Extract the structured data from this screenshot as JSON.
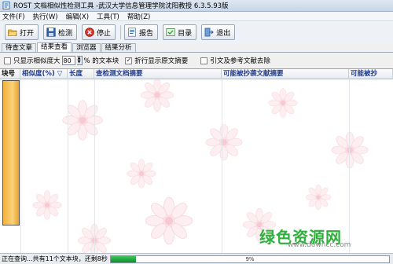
{
  "window": {
    "title": "ROST 文档相似性检测工具 -武汉大学信息管理学院沈阳教授 6.3.5.93版"
  },
  "menu": [
    "文件(F)",
    "执行(W)",
    "编辑(X)",
    "工具(T)",
    "帮助(Z)"
  ],
  "toolbar": {
    "open": "打开",
    "detect": "检测",
    "stop": "停止",
    "report": "报告",
    "catalog": "目录",
    "exit": "退出"
  },
  "tabs": [
    "待查文章",
    "结果查看",
    "浏览器",
    "结果分析"
  ],
  "active_tab": "结果查看",
  "options": {
    "show_similarity_label": "只显示相似度大",
    "similarity_value": "80",
    "percent_text_label": "% 的文本块",
    "show_fold_label": "折行显示原文摘要",
    "show_fold_checked": true,
    "exclude_refs_label": "引文及参考文献去除",
    "exclude_refs_checked": false,
    "show_similarity_checked": false
  },
  "table": {
    "columns": [
      "块号",
      "相似度(%)",
      "长度",
      "查检测文档摘要",
      "可能被抄袭文献摘要",
      "可能被抄"
    ],
    "sort_indicator": "▽"
  },
  "watermark": {
    "main": "绿色资源网",
    "sub": "www.downcc.com"
  },
  "status": {
    "text": "正在查询...共有11个文本块，还剩8秒",
    "progress_percent": 9,
    "progress_label": "9%"
  },
  "colors": {
    "progress": "#1fa83d",
    "header_text": "#1e3a8a",
    "watermark": "#2fb03c"
  }
}
